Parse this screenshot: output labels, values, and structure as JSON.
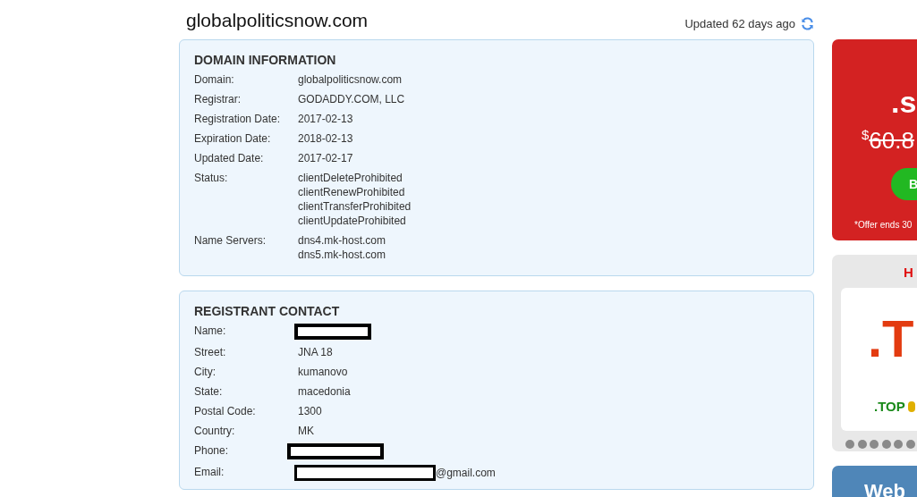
{
  "site_title": "globalpoliticsnow.com",
  "updated": "Updated 62 days ago",
  "domain_information": {
    "heading": "DOMAIN INFORMATION",
    "fields": [
      {
        "label": "Domain:",
        "values": [
          "globalpoliticsnow.com"
        ]
      },
      {
        "label": "Registrar:",
        "values": [
          "GODADDY.COM, LLC"
        ]
      },
      {
        "label": "Registration Date:",
        "values": [
          "2017-02-13"
        ]
      },
      {
        "label": "Expiration Date:",
        "values": [
          "2018-02-13"
        ]
      },
      {
        "label": "Updated Date:",
        "values": [
          "2017-02-17"
        ]
      },
      {
        "label": "Status:",
        "values": [
          "clientDeleteProhibited",
          "clientRenewProhibited",
          "clientTransferProhibited",
          "clientUpdateProhibited"
        ]
      },
      {
        "label": "Name Servers:",
        "values": [
          "dns4.mk-host.com",
          "dns5.mk-host.com"
        ]
      }
    ]
  },
  "registrant_contact": {
    "heading": "REGISTRANT CONTACT",
    "fields": [
      {
        "label": "Name:",
        "redacted": true
      },
      {
        "label": "Street:",
        "redacted": false,
        "value": "JNA 18"
      },
      {
        "label": "City:",
        "redacted": false,
        "value": "kumanovo"
      },
      {
        "label": "State:",
        "redacted": false,
        "value": "macedonia"
      },
      {
        "label": "Postal Code:",
        "redacted": false,
        "value": "1300"
      },
      {
        "label": "Country:",
        "redacted": false,
        "value": "MK"
      },
      {
        "label": "Phone:",
        "redacted": true
      },
      {
        "label": "Email:",
        "redacted": true,
        "value": "@gmail.com"
      }
    ]
  },
  "ads": [
    {
      "kind": "offer",
      "headline": ".s",
      "currency": "$",
      "old_price": "60.8",
      "button": "B",
      "note": "*Offer ends 30"
    },
    {
      "kind": "carousel",
      "title": "H",
      "big_text": ".T",
      "caption": ".TOP"
    },
    {
      "kind": "banner",
      "title": "Web"
    }
  ]
}
